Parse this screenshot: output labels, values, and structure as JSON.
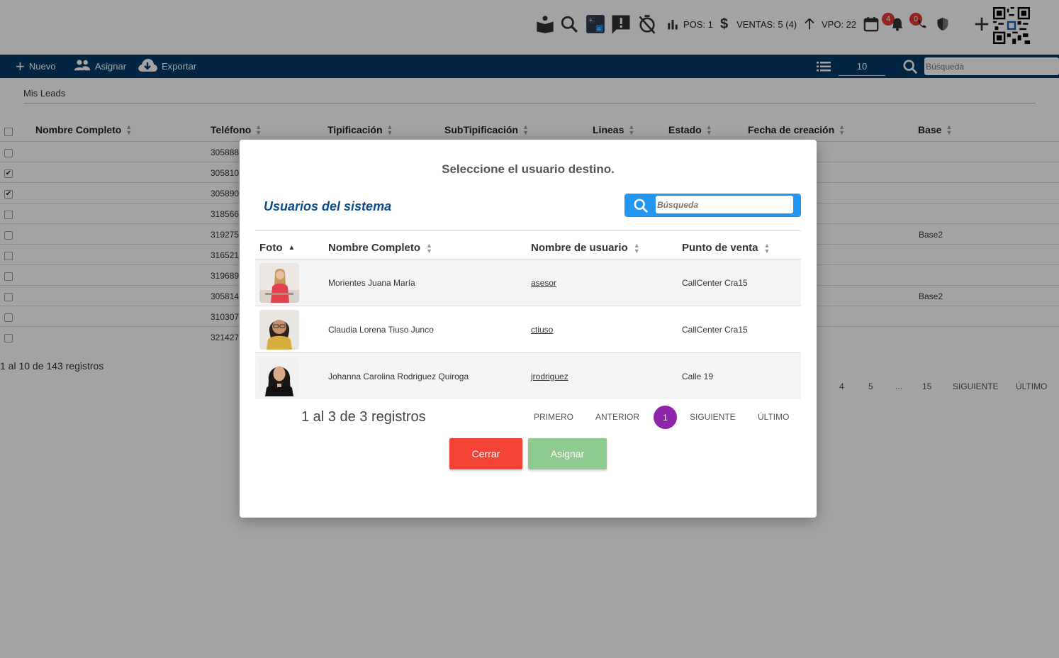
{
  "topbar": {
    "pos_label": "POS: 1",
    "ventas_label": "VENTAS: 5 (4)",
    "vpo_label": "VPO: 22",
    "calendar_badge": "4",
    "notif_badge": "0",
    "colors": {
      "badge": "#e53935"
    }
  },
  "toolbar": {
    "new_label": "Nuevo",
    "assign_label": "Asignar",
    "export_label": "Exportar",
    "page_size": "10",
    "search_placeholder": "Búsqueda"
  },
  "breadcrumb": "Mis Leads",
  "leads_table": {
    "headers": [
      "Nombre Completo",
      "Teléfono",
      "Tipificación",
      "SubTipificación",
      "Lineas",
      "Estado",
      "Fecha de creación",
      "Base"
    ],
    "rows": [
      {
        "phone": "305888",
        "checked": false,
        "base": ""
      },
      {
        "phone": "305810",
        "checked": true,
        "base": ""
      },
      {
        "phone": "305890",
        "checked": true,
        "base": ""
      },
      {
        "phone": "318566",
        "checked": false,
        "base": ""
      },
      {
        "phone": "319275",
        "checked": false,
        "base": "Base2"
      },
      {
        "phone": "316521",
        "checked": false,
        "base": ""
      },
      {
        "phone": "319689",
        "checked": false,
        "base": ""
      },
      {
        "phone": "305814",
        "checked": false,
        "base": "Base2"
      },
      {
        "phone": "310307",
        "checked": false,
        "base": ""
      },
      {
        "phone": "321427",
        "checked": false,
        "base": ""
      }
    ],
    "footer": "1 al 10 de 143 registros",
    "pagination": [
      "4",
      "5",
      "...",
      "15",
      "SIGUIENTE",
      "ÚLTIMO"
    ]
  },
  "modal": {
    "title": "Seleccione el usuario destino.",
    "subtitle": "Usuarios del sistema",
    "search_placeholder": "Búsqueda",
    "headers": {
      "photo": "Foto",
      "name": "Nombre Completo",
      "username": "Nombre de usuario",
      "pdv": "Punto de venta"
    },
    "users": [
      {
        "name": "Morientes Juana María",
        "username": "asesor",
        "pdv": "CallCenter Cra15"
      },
      {
        "name": "Claudia Lorena Tiuso Junco",
        "username": "ctiuso",
        "pdv": "CallCenter Cra15"
      },
      {
        "name": "Johanna Carolina Rodriguez Quiroga",
        "username": "jrodriguez",
        "pdv": "Calle 19"
      }
    ],
    "footer": "1 al 3 de 3 registros",
    "pagination": {
      "first": "PRIMERO",
      "prev": "ANTERIOR",
      "current": "1",
      "next": "SIGUIENTE",
      "last": "ÚLTIMO"
    },
    "close_label": "Cerrar",
    "assign_label": "Asignar",
    "colors": {
      "close": "#f44336",
      "assign": "#8fcb8f",
      "accent": "#2196f3",
      "page_active": "#8e24aa"
    }
  }
}
